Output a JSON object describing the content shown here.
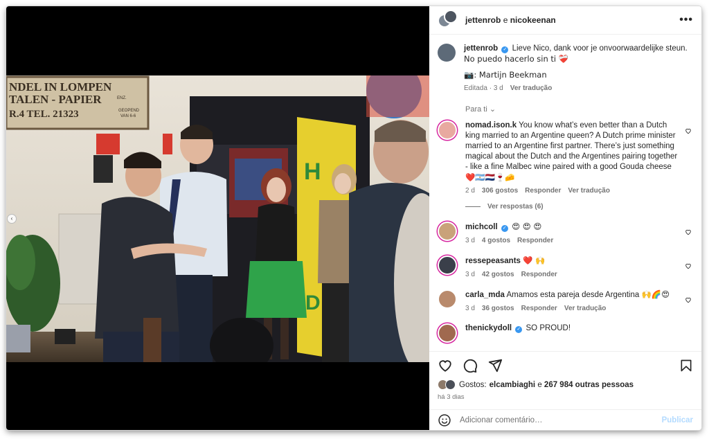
{
  "header": {
    "user1": "jettenrob",
    "separator": "e",
    "user2": "nicokeenan",
    "more_icon": "more-horizontal-icon"
  },
  "caption": {
    "username": "jettenrob",
    "text_line1": "Lieve Nico, dank voor je onvoorwaardelijke steun.",
    "text_line2": "No puedo hacerlo sin ti ❤️‍🩹",
    "credit": "📷: Martijn Beekman",
    "edited": "Editada",
    "age": "3 d",
    "translate": "Ver tradução"
  },
  "filter_label": "Para ti",
  "comments": [
    {
      "username": "nomad.ison.k",
      "verified": false,
      "text": "You know what’s even better than a Dutch king married to an Argentine queen? A Dutch prime minister married to an Argentine first partner. There’s just something magical about the Dutch and the Argentines pairing together - like a fine Malbec wine paired with a good Gouda cheese",
      "emojis": "❤️🇦🇷🇳🇱🍷🧀",
      "age": "2 d",
      "likes": "306 gostos",
      "reply": "Responder",
      "translate": "Ver tradução",
      "view_replies": "Ver respostas (6)",
      "avatar_color": "#e8a9a0"
    },
    {
      "username": "michcoll",
      "verified": true,
      "text": "",
      "emojis": "😍 😍 😍",
      "age": "3 d",
      "likes": "4 gostos",
      "reply": "Responder",
      "translate": "",
      "avatar_color": "#c9a27a"
    },
    {
      "username": "ressepeasants",
      "verified": false,
      "text": "",
      "emojis": "❤️ 🙌",
      "age": "3 d",
      "likes": "42 gostos",
      "reply": "Responder",
      "translate": "",
      "avatar_color": "#3a3f4a"
    },
    {
      "username": "carla_mda",
      "verified": false,
      "text": "Amamos esta pareja desde Argentina",
      "emojis": "🙌🌈😍",
      "age": "3 d",
      "likes": "36 gostos",
      "reply": "Responder",
      "translate": "Ver tradução",
      "avatar_color": "#b98a6c"
    },
    {
      "username": "thenickydoll",
      "verified": true,
      "text": "SO PROUD!",
      "emojis": "",
      "avatar_color": "#a0694f"
    }
  ],
  "actions": {
    "like_icon": "heart-outline-icon",
    "comment_icon": "comment-icon",
    "share_icon": "paper-plane-icon",
    "save_icon": "bookmark-icon"
  },
  "likes": {
    "label": "Gostos:",
    "first": "elcambiaghi",
    "conj": "e",
    "rest": "267 984 outras pessoas"
  },
  "posted": "há 3 dias",
  "add_comment": {
    "placeholder": "Adicionar comentário…",
    "publish": "Publicar",
    "emoji_icon": "smiley-icon"
  },
  "photo": {
    "sign_line1": "NDEL IN LOMPEN",
    "sign_line2": "TALEN - PAPIER",
    "sign_line3": "R.4 TEL. 21323",
    "sign_small1": "ENZ.",
    "sign_small2": "GEOPEND",
    "sign_small3": "VAN 6-6",
    "banner_letters": "H",
    "banner_letter2": "D"
  },
  "colors": {
    "accent_blue": "#0095f6",
    "publish_disabled": "#b3dbff",
    "verified": "#3897f0",
    "muted_text": "#737373"
  }
}
